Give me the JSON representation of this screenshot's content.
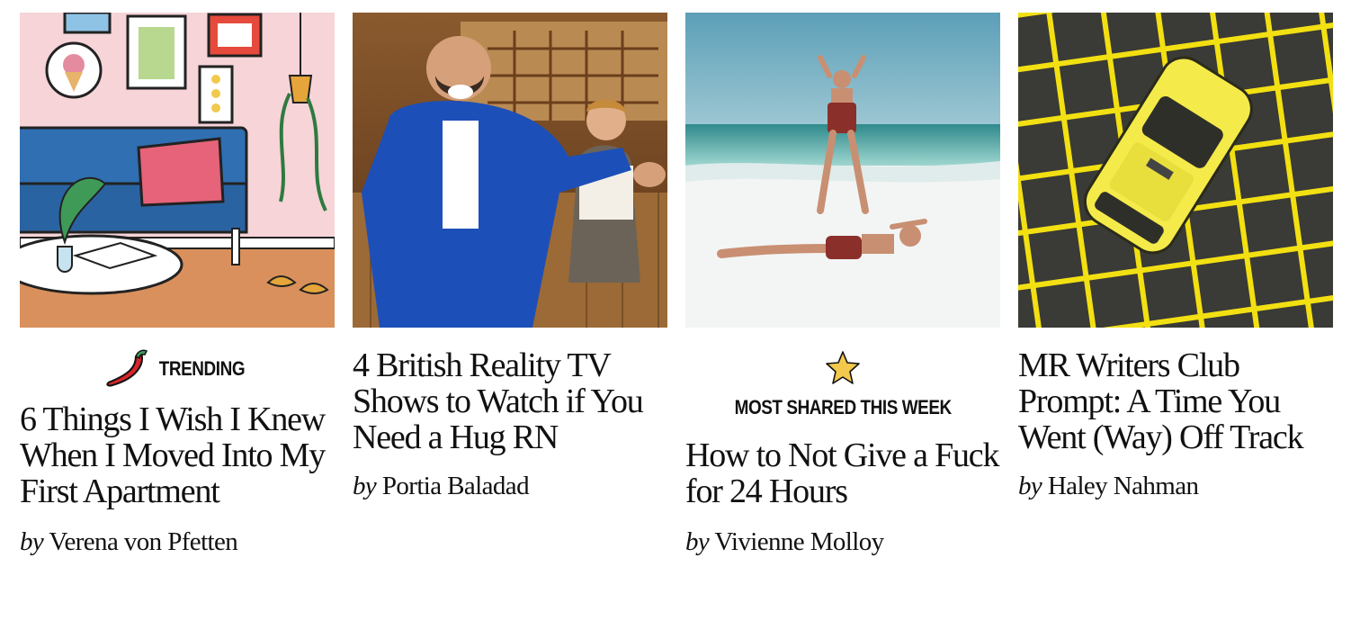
{
  "articles": [
    {
      "badge": {
        "label": "TRENDING",
        "icon": "chili-pepper-icon"
      },
      "title": "6 Things I Wish I Knew When I Moved Into My First Apartment",
      "by": "by",
      "author": "Verena von Pfetten",
      "image": "illustration-apartment-living-room"
    },
    {
      "title": "4 British Reality TV Shows to Watch if You Need a Hug RN",
      "by": "by",
      "author": "Portia Baladad",
      "image": "photo-man-blue-suit-restaurant"
    },
    {
      "badge": {
        "label": "MOST SHARED THIS WEEK",
        "icon": "star-icon"
      },
      "title": "How to Not Give a Fuck for 24 Hours",
      "by": "by",
      "author": "Vivienne Molloy",
      "image": "photo-women-beach"
    },
    {
      "title": "MR Writers Club Prompt: A Time You Went (Way) Off Track",
      "by": "by",
      "author": "Haley Nahman",
      "image": "photo-yellow-taxi-grid"
    }
  ],
  "colors": {
    "accent_star": "#f2c94c",
    "chili": "#d7262b",
    "taxi_yellow": "#f4ea4a",
    "suit_blue": "#1d4fb8"
  }
}
